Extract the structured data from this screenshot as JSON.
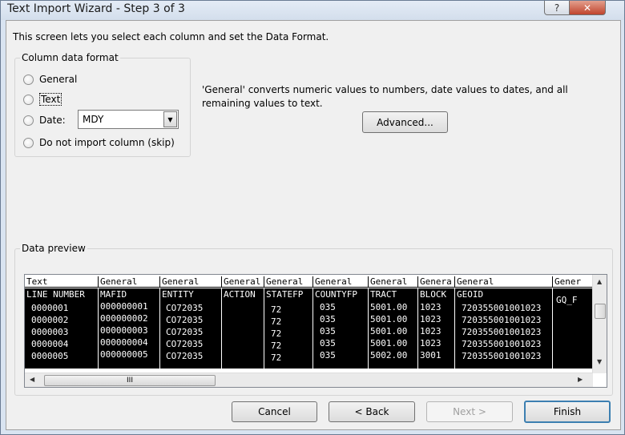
{
  "window": {
    "title": "Text Import Wizard - Step 3 of 3",
    "help_glyph": "?",
    "close_glyph": "✕"
  },
  "intro": "This screen lets you select each column and set the Data Format.",
  "column_format": {
    "legend": "Column data format",
    "options": [
      {
        "label": "General",
        "selected": false
      },
      {
        "label": "Text",
        "selected": false
      },
      {
        "label": "Date:",
        "selected": false
      },
      {
        "label": "Do not import column (skip)",
        "selected": false
      }
    ],
    "date_value": "MDY"
  },
  "description": "'General' converts numeric values to numbers, date values to dates, and all remaining values to text.",
  "advanced_label": "Advanced...",
  "preview": {
    "legend": "Data preview",
    "header_types": [
      "Text",
      "General",
      "General",
      "General",
      "General",
      "General",
      "General",
      "Genera",
      "General",
      "Gener"
    ],
    "columns": [
      [
        "LINE NUMBER",
        "0000001",
        "0000002",
        "0000003",
        "0000004",
        "0000005"
      ],
      [
        "MAFID",
        "000000001",
        "000000002",
        "000000003",
        "000000004",
        "000000005"
      ],
      [
        "ENTITY",
        "CO72035",
        "CO72035",
        "CO72035",
        "CO72035",
        "CO72035"
      ],
      [
        "ACTION",
        "",
        "",
        "",
        "",
        ""
      ],
      [
        "STATEFP",
        "72",
        "72",
        "72",
        "72",
        "72"
      ],
      [
        "COUNTYFP",
        "035",
        "035",
        "035",
        "035",
        "035"
      ],
      [
        "TRACT",
        "5001.00",
        "5001.00",
        "5001.00",
        "5001.00",
        "5002.00"
      ],
      [
        "BLOCK",
        "1023",
        "1023",
        "1023",
        "1023",
        "3001"
      ],
      [
        "GEOID",
        "720355001001023",
        "720355001001023",
        "720355001001023",
        "720355001001023",
        "720355001001023"
      ],
      [
        "GQ_F",
        "",
        "",
        "",
        "",
        ""
      ]
    ],
    "hscroll_grip": "III"
  },
  "buttons": {
    "cancel": "Cancel",
    "back": "< Back",
    "next": "Next >",
    "finish": "Finish"
  }
}
